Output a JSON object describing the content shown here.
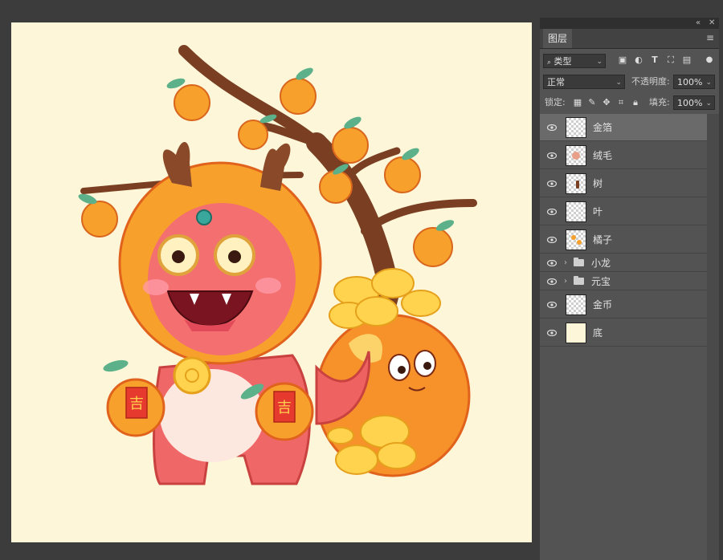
{
  "panel": {
    "collapse_glyph": "«",
    "close_glyph": "✕",
    "tab_label": "图层",
    "menu_glyph": "≡",
    "filter": {
      "search_glyph": "🔍",
      "value": "类型",
      "icons": [
        "image-icon",
        "adjustment-icon",
        "type-icon",
        "shape-icon",
        "smart-object-icon"
      ]
    },
    "blend": {
      "value": "正常",
      "opacity_label": "不透明度:",
      "opacity_value": "100%"
    },
    "lock": {
      "label": "锁定:",
      "fill_label": "填充:",
      "fill_value": "100%"
    }
  },
  "layers": [
    {
      "name": "金箔",
      "type": "pixel",
      "selected": true,
      "visible": true
    },
    {
      "name": "绒毛",
      "type": "pixel",
      "selected": false,
      "visible": true
    },
    {
      "name": "树",
      "type": "pixel",
      "selected": false,
      "visible": true
    },
    {
      "name": "叶",
      "type": "pixel",
      "selected": false,
      "visible": true
    },
    {
      "name": "橘子",
      "type": "pixel",
      "selected": false,
      "visible": true
    },
    {
      "name": "小龙",
      "type": "group",
      "selected": false,
      "visible": true
    },
    {
      "name": "元宝",
      "type": "group",
      "selected": false,
      "visible": true
    },
    {
      "name": "金币",
      "type": "pixel",
      "selected": false,
      "visible": true
    },
    {
      "name": "底",
      "type": "solid",
      "selected": false,
      "visible": true
    }
  ],
  "artwork": {
    "red_tag_text": "吉",
    "colors": {
      "background": "#fdf6d8",
      "orange": "#f7a12c",
      "dragon": "#f06a6a",
      "gold": "#ffd34d",
      "trunk": "#8a4a2a"
    }
  }
}
